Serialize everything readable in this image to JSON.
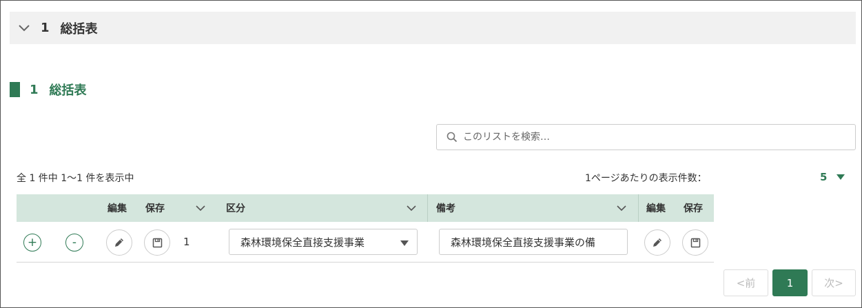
{
  "section": {
    "number": "1",
    "title": "総括表"
  },
  "sub_section": {
    "number": "1",
    "title": "総括表"
  },
  "search": {
    "placeholder": "このリストを検索…"
  },
  "list_info": {
    "count_text": "全 1 件中 1～1 件を表示中",
    "per_page_label": "1ページあたりの表示件数：",
    "per_page_value": "5"
  },
  "table": {
    "headers": {
      "edit": "編集",
      "save": "保存",
      "category": "区分",
      "remarks": "備考",
      "edit2": "編集",
      "save2": "保存"
    },
    "rows": [
      {
        "add_symbol": "+",
        "remove_symbol": "-",
        "number": "1",
        "category": "森林環境保全直接支援事業",
        "remarks": "森林環境保全直接支援事業の備"
      }
    ]
  },
  "pagination": {
    "prev": "<前",
    "current": "1",
    "next": "次>"
  },
  "colors": {
    "accent": "#2f7a55",
    "header_bg": "#f1f1f1",
    "table_header_bg": "#d4e6dd"
  },
  "icons": [
    "chevron-down-icon",
    "search-icon",
    "pencil-icon",
    "save-icon",
    "triangle-down-icon",
    "plus-icon",
    "minus-icon"
  ]
}
